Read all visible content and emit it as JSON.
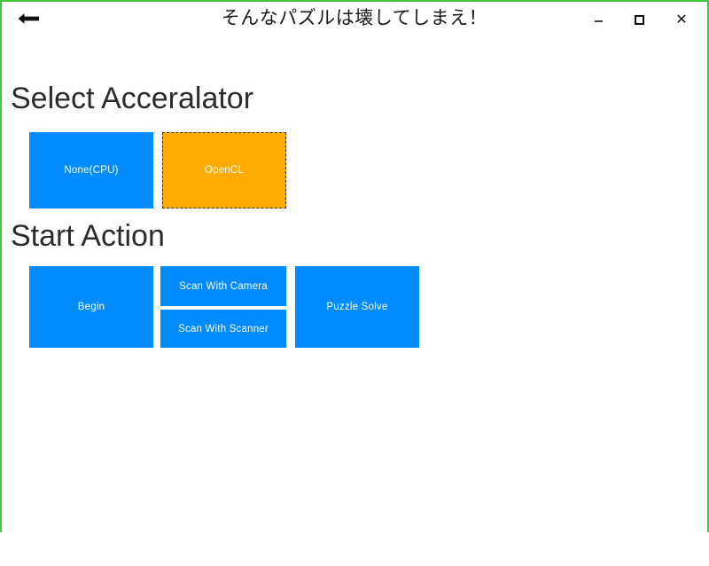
{
  "window": {
    "title": "そんなパズルは壊してしまえ！",
    "border_color": "#3dc93a",
    "background_color": "#ffffff",
    "back_label": "←",
    "back_icon": "back-arrow-icon",
    "controls": {
      "minimize_label": "-",
      "minimize_icon": "minimize-icon",
      "maximize_label": "□",
      "maximize_icon": "maximize-icon",
      "close_label": "✕",
      "close_icon": "close-icon"
    }
  },
  "sections": {
    "accelerator": {
      "heading": "Select Acceralator",
      "tiles": [
        {
          "label": "None(CPU)",
          "color": "#008cff",
          "selected": false
        },
        {
          "label": "OpenCL",
          "color": "#ffab00",
          "selected": true
        }
      ]
    },
    "start_action": {
      "heading": "Start Action",
      "tiles": [
        {
          "label": "Begin",
          "color": "#008cff"
        },
        {
          "label": "Scan With Camera",
          "color": "#008cff"
        },
        {
          "label": "Scan With Scanner",
          "color": "#008cff"
        },
        {
          "label": "Puzzle Solve",
          "color": "#008cff"
        }
      ]
    }
  },
  "colors": {
    "accent_blue": "#008cff",
    "accent_orange": "#ffab00",
    "focus_outline": "#3b2d00",
    "window_border_green": "#3dc93a",
    "heading_text": "#2b2b2b",
    "tile_text": "#ffffff"
  }
}
